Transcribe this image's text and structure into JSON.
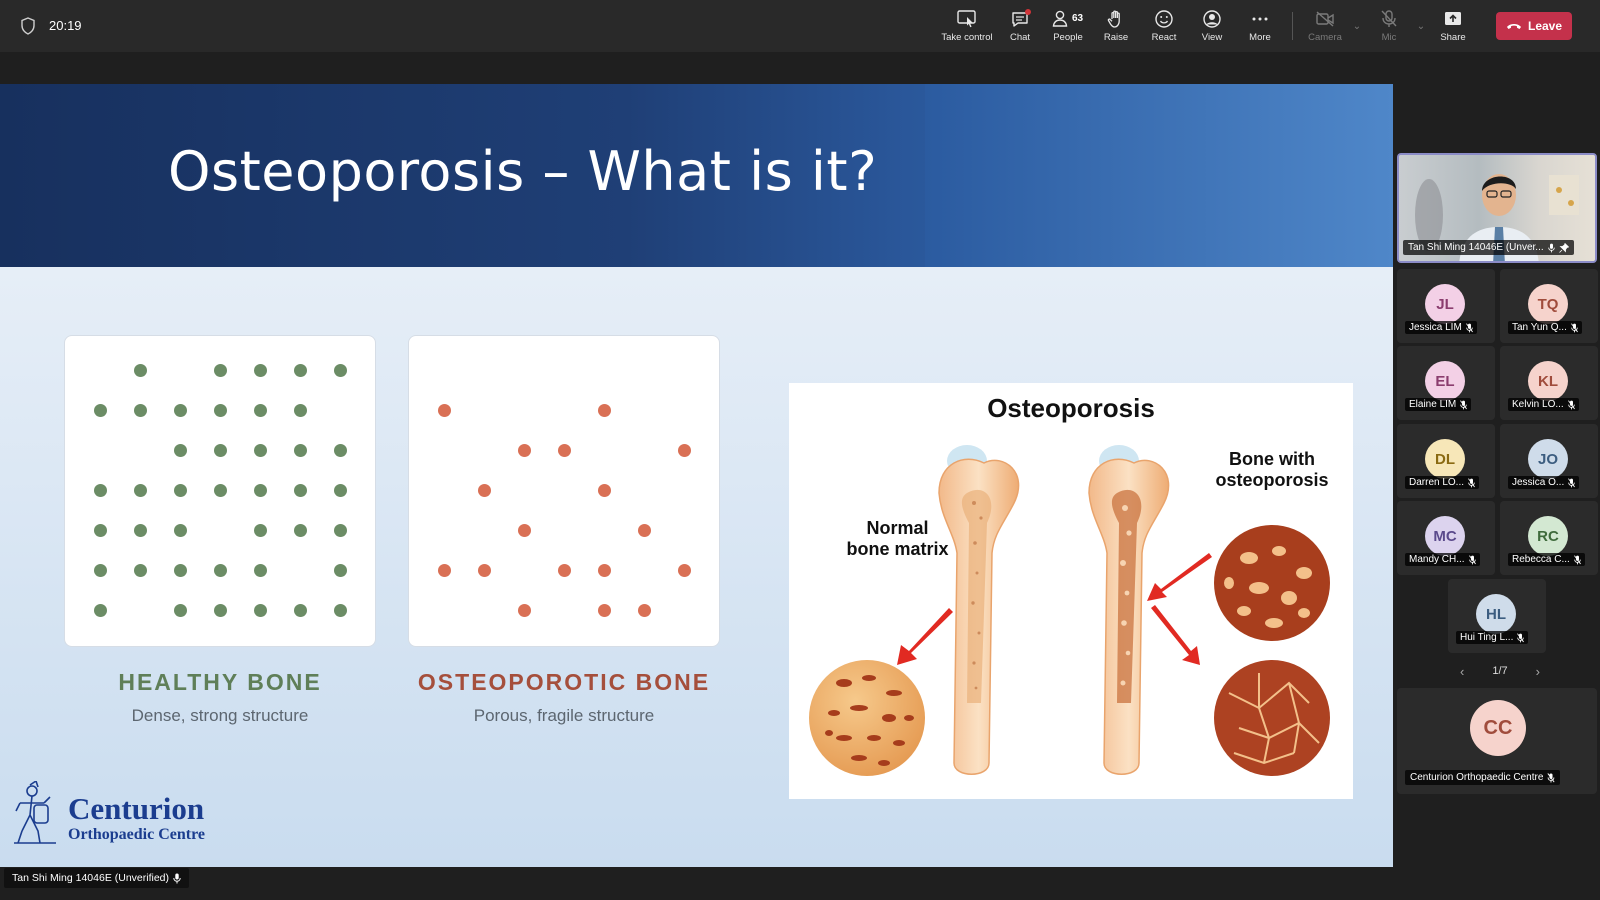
{
  "meeting": {
    "time": "20:19",
    "toolbar": {
      "take_control": "Take control",
      "chat": "Chat",
      "people": "People",
      "people_count": "63",
      "raise": "Raise",
      "react": "React",
      "view": "View",
      "more": "More",
      "camera": "Camera",
      "mic": "Mic",
      "share": "Share",
      "leave": "Leave"
    },
    "colors": {
      "leave": "#c4314b",
      "toolbar_bg": "#292929",
      "active_border": "#8b8cc7"
    }
  },
  "slide": {
    "title": "Osteoporosis – What is it?",
    "healthy": {
      "title": "HEALTHY BONE",
      "subtitle": "Dense, strong structure"
    },
    "osteoporotic": {
      "title": "OSTEOPOROTIC BONE",
      "subtitle": "Porous, fragile structure"
    },
    "diagram": {
      "title": "Osteoporosis",
      "label_normal": "Normal bone matrix",
      "label_osteo": "Bone with osteoporosis"
    },
    "logo": {
      "name": "Centurion",
      "sub": "Orthopaedic Centre"
    }
  },
  "presenter_label": "Tan Shi Ming 14046E (Unverified)",
  "panel": {
    "main_video_name": "Tan Shi Ming 14046E (Unver...",
    "participants": [
      {
        "initials": "JL",
        "name": "Jessica LIM",
        "bg": "#f3d0e6",
        "fg": "#8b3d6f"
      },
      {
        "initials": "TQ",
        "name": "Tan Yun Q...",
        "bg": "#f6d3cc",
        "fg": "#a04c3c"
      },
      {
        "initials": "EL",
        "name": "Elaine LIM",
        "bg": "#f3d0e6",
        "fg": "#8b3d6f"
      },
      {
        "initials": "KL",
        "name": "Kelvin LO...",
        "bg": "#f6d3cc",
        "fg": "#a04c3c"
      },
      {
        "initials": "DL",
        "name": "Darren LO...",
        "bg": "#f7e7b8",
        "fg": "#8a6a12"
      },
      {
        "initials": "JO",
        "name": "Jessica O...",
        "bg": "#cfdcea",
        "fg": "#3c5d80"
      },
      {
        "initials": "MC",
        "name": "Mandy CH...",
        "bg": "#dcd3ee",
        "fg": "#5b4a8c"
      },
      {
        "initials": "RC",
        "name": "Rebecca C...",
        "bg": "#d3e8d2",
        "fg": "#3f6b3c"
      },
      {
        "initials": "HL",
        "name": "Hui Ting L...",
        "bg": "#cfdcea",
        "fg": "#3c5d80"
      }
    ],
    "pager": "1/7",
    "org_tile": {
      "initials": "CC",
      "name": "Centurion Orthopaedic Centre"
    }
  }
}
